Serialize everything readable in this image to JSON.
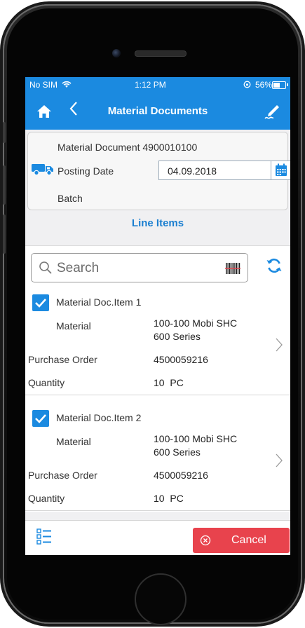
{
  "status_bar": {
    "carrier": "No SIM",
    "time": "1:12 PM",
    "battery": "56%"
  },
  "header": {
    "title": "Material Documents"
  },
  "document": {
    "material_document": "Material Document 4900010100",
    "posting_date_label": "Posting Date",
    "posting_date_value": "04.09.2018",
    "batch_label": "Batch"
  },
  "section": {
    "line_items_label": "Line Items"
  },
  "search": {
    "placeholder": "Search"
  },
  "items": [
    {
      "title": "Material Doc.Item 1",
      "checked": true,
      "material_label": "Material",
      "material_line1": "100-100 Mobi SHC",
      "material_line2": "600 Series",
      "po_label": "Purchase Order",
      "po_value": "4500059216",
      "qty_label": "Quantity",
      "qty_value": "10  PC"
    },
    {
      "title": "Material Doc.Item 2",
      "checked": true,
      "material_label": "Material",
      "material_line1": "100-100 Mobi SHC",
      "material_line2": "600 Series",
      "po_label": "Purchase Order",
      "po_value": "4500059216",
      "qty_label": "Quantity",
      "qty_value": "10  PC"
    }
  ],
  "footer": {
    "cancel_label": "Cancel"
  },
  "colors": {
    "header": "#1b8ae0",
    "accent": "#1b7fd0",
    "cancel": "#e8434d"
  }
}
